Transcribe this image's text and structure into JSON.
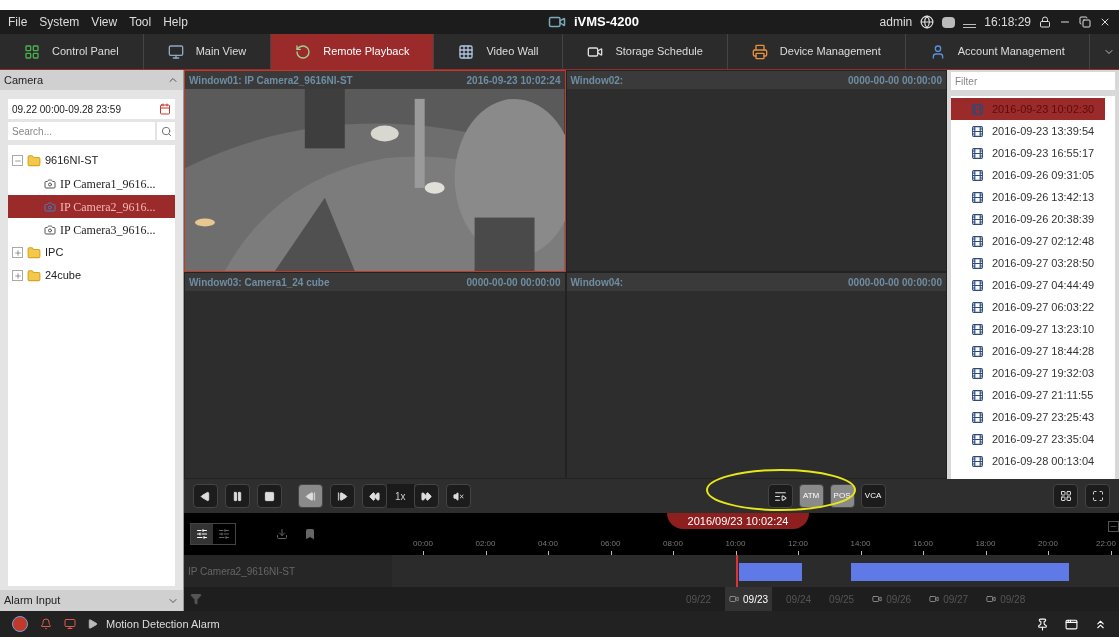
{
  "menu": [
    "File",
    "System",
    "View",
    "Tool",
    "Help"
  ],
  "app_title": "iVMS-4200",
  "user": "admin",
  "clock": "16:18:29",
  "nav_tabs": [
    {
      "label": "Control Panel",
      "selected": false
    },
    {
      "label": "Main View",
      "selected": false
    },
    {
      "label": "Remote Playback",
      "selected": true
    },
    {
      "label": "Video Wall",
      "selected": false
    },
    {
      "label": "Storage Schedule",
      "selected": false
    },
    {
      "label": "Device Management",
      "selected": false
    },
    {
      "label": "Account Management",
      "selected": false
    }
  ],
  "camera_panel": {
    "title": "Camera",
    "date_range": "09.22 00:00-09.28 23:59",
    "search": {
      "placeholder": "Search..."
    },
    "tree": [
      {
        "label": "9616NI-ST",
        "expanded": true,
        "children": [
          {
            "label": "IP Camera1_9616...",
            "selected": false
          },
          {
            "label": "IP Camera2_9616...",
            "selected": true
          },
          {
            "label": "IP Camera3_9616...",
            "selected": false
          }
        ]
      },
      {
        "label": "IPC",
        "expanded": false
      },
      {
        "label": "24cube",
        "expanded": false
      }
    ],
    "footer": "Alarm Input"
  },
  "windows": [
    {
      "title": "Window01: IP Camera2_9616NI-ST",
      "time": "2016-09-23 10:02:24",
      "selected": true,
      "kind": "picture"
    },
    {
      "title": "Window02:",
      "time": "0000-00-00 00:00:00",
      "selected": false,
      "kind": "empty"
    },
    {
      "title": "Window03: Camera1_24 cube",
      "time": "0000-00-00 00:00:00",
      "selected": false,
      "kind": "empty"
    },
    {
      "title": "Window04:",
      "time": "0000-00-00 00:00:00",
      "selected": false,
      "kind": "empty"
    }
  ],
  "recordings": {
    "filter": {
      "placeholder": "Filter"
    },
    "items": [
      {
        "label": "2016-09-23 10:02:30",
        "selected": true
      },
      {
        "label": "2016-09-23 13:39:54",
        "selected": false
      },
      {
        "label": "2016-09-23 16:55:17",
        "selected": false
      },
      {
        "label": "2016-09-26 09:31:05",
        "selected": false
      },
      {
        "label": "2016-09-26 13:42:13",
        "selected": false
      },
      {
        "label": "2016-09-26 20:38:39",
        "selected": false
      },
      {
        "label": "2016-09-27 02:12:48",
        "selected": false
      },
      {
        "label": "2016-09-27 03:28:50",
        "selected": false
      },
      {
        "label": "2016-09-27 04:44:49",
        "selected": false
      },
      {
        "label": "2016-09-27 06:03:22",
        "selected": false
      },
      {
        "label": "2016-09-27 13:23:10",
        "selected": false
      },
      {
        "label": "2016-09-27 18:44:28",
        "selected": false
      },
      {
        "label": "2016-09-27 19:32:03",
        "selected": false
      },
      {
        "label": "2016-09-27 21:11:55",
        "selected": false
      },
      {
        "label": "2016-09-27 23:25:43",
        "selected": false
      },
      {
        "label": "2016-09-27 23:35:04",
        "selected": false
      },
      {
        "label": "2016-09-28 00:13:04",
        "selected": false
      }
    ]
  },
  "playback_buttons": [
    {
      "kind": "reverse",
      "active": false
    },
    {
      "kind": "pause",
      "active": false
    },
    {
      "kind": "stop",
      "active": false
    },
    {
      "kind": "step-back",
      "active": true
    },
    {
      "kind": "step-forward",
      "active": false
    },
    {
      "kind": "slow",
      "active": false
    },
    {
      "kind": "speed",
      "label": "1x",
      "active": false
    },
    {
      "kind": "fast",
      "active": false
    },
    {
      "kind": "mute",
      "active": false
    }
  ],
  "tool_buttons": [
    {
      "kind": "list",
      "active": false
    },
    {
      "kind": "text",
      "label": "ATM",
      "active": true
    },
    {
      "kind": "text",
      "label": "POS",
      "active": true
    },
    {
      "kind": "text",
      "label": "VCA",
      "active": false
    }
  ],
  "timeline": {
    "current_time": "2016/09/23 10:02:24",
    "ticks": [
      "00:00",
      "02:00",
      "04:00",
      "06:00",
      "08:00",
      "10:00",
      "12:00",
      "14:00",
      "16:00",
      "18:00",
      "20:00",
      "22:00"
    ],
    "track": "IP Camera2_9616NI-ST",
    "dates": [
      {
        "label": "09/22",
        "recorded": false,
        "selected": false
      },
      {
        "label": "09/23",
        "recorded": true,
        "selected": true
      },
      {
        "label": "09/24",
        "recorded": false,
        "selected": false
      },
      {
        "label": "09/25",
        "recorded": false,
        "selected": false
      },
      {
        "label": "09/26",
        "recorded": true,
        "selected": false
      },
      {
        "label": "09/27",
        "recorded": true,
        "selected": false
      },
      {
        "label": "09/28",
        "recorded": true,
        "selected": false
      }
    ]
  },
  "status_bar": {
    "alarm": "Motion Detection Alarm"
  }
}
